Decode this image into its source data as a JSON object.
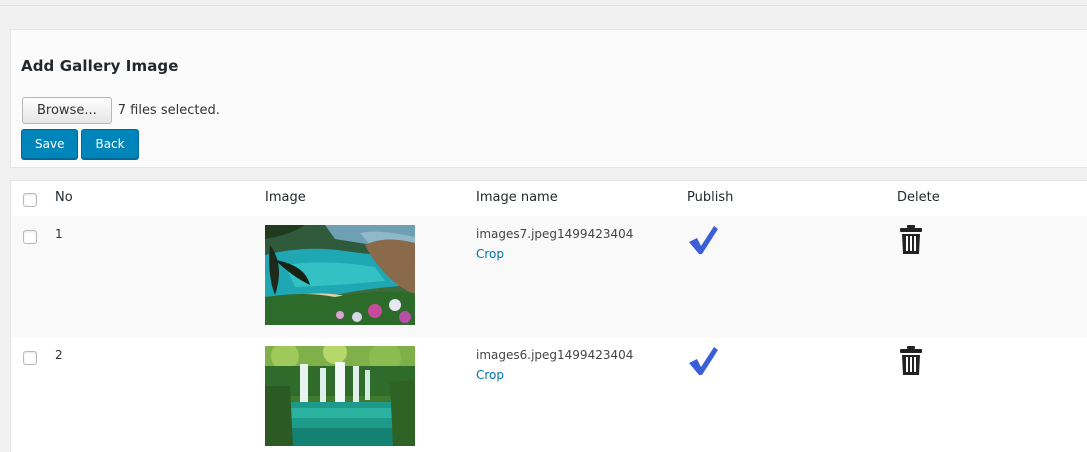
{
  "form": {
    "title": "Add Gallery Image",
    "browse_label": "Browse...",
    "files_selected": "7 files selected.",
    "save_label": "Save",
    "back_label": "Back"
  },
  "table": {
    "columns": [
      "No",
      "Image",
      "Image name",
      "Publish",
      "Delete"
    ],
    "rows": [
      {
        "no": "1",
        "image_name": "images7.jpeg1499423404",
        "crop": "Crop",
        "published": true,
        "thumbnail": "coastal-lagoon-photo"
      },
      {
        "no": "2",
        "image_name": "images6.jpeg1499423404",
        "crop": "Crop",
        "published": true,
        "thumbnail": "waterfall-photo"
      }
    ]
  },
  "colors": {
    "primary": "#0085ba",
    "link": "#0073aa",
    "checkmark": "#3a5fd9"
  },
  "icons": {
    "publish": "checkmark-icon",
    "delete": "trash-icon"
  }
}
